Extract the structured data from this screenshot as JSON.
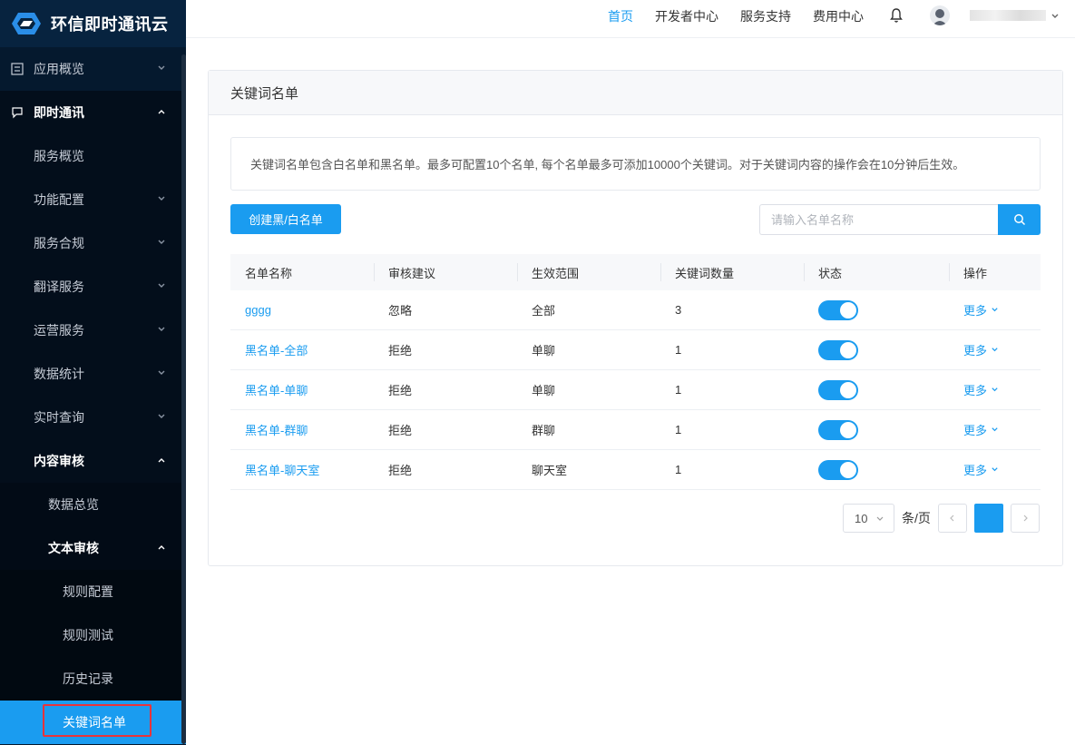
{
  "app": {
    "title": "环信即时通讯云"
  },
  "topnav": {
    "items": [
      "首页",
      "开发者中心",
      "服务支持",
      "费用中心"
    ]
  },
  "sidebar": {
    "items": [
      {
        "label": "应用概览",
        "level": 1
      },
      {
        "label": "即时通讯",
        "level": 1
      },
      {
        "label": "服务概览",
        "level": 2
      },
      {
        "label": "功能配置",
        "level": 2
      },
      {
        "label": "服务合规",
        "level": 2
      },
      {
        "label": "翻译服务",
        "level": 2
      },
      {
        "label": "运营服务",
        "level": 2
      },
      {
        "label": "数据统计",
        "level": 2
      },
      {
        "label": "实时查询",
        "level": 2
      },
      {
        "label": "内容审核",
        "level": 2
      },
      {
        "label": "数据总览",
        "level": 3
      },
      {
        "label": "文本审核",
        "level": 3
      },
      {
        "label": "规则配置",
        "level": 4
      },
      {
        "label": "规则测试",
        "level": 4
      },
      {
        "label": "历史记录",
        "level": 4
      },
      {
        "label": "关键词名单",
        "level": 4
      }
    ],
    "active": "关键词名单"
  },
  "panel": {
    "title": "关键词名单",
    "notice": "关键词名单包含白名单和黑名单。最多可配置10个名单, 每个名单最多可添加10000个关键词。对于关键词内容的操作会在10分钟后生效。",
    "create_button": "创建黑/白名单",
    "search_placeholder": "请输入名单名称"
  },
  "table": {
    "headers": [
      "名单名称",
      "审核建议",
      "生效范围",
      "关键词数量",
      "状态",
      "操作"
    ],
    "rows": [
      {
        "name": "gggg",
        "advice": "忽略",
        "scope": "全部",
        "count": "3",
        "enabled": true,
        "action": "更多"
      },
      {
        "name": "黑名单-全部",
        "advice": "拒绝",
        "scope": "单聊",
        "count": "1",
        "enabled": true,
        "action": "更多"
      },
      {
        "name": "黑名单-单聊",
        "advice": "拒绝",
        "scope": "单聊",
        "count": "1",
        "enabled": true,
        "action": "更多"
      },
      {
        "name": "黑名单-群聊",
        "advice": "拒绝",
        "scope": "群聊",
        "count": "1",
        "enabled": true,
        "action": "更多"
      },
      {
        "name": "黑名单-聊天室",
        "advice": "拒绝",
        "scope": "聊天室",
        "count": "1",
        "enabled": true,
        "action": "更多"
      }
    ]
  },
  "pagination": {
    "page_size": "10",
    "per_page_label": "条/页"
  },
  "colors": {
    "accent": "#1a9cf0",
    "sidebar_bg": "#05192e",
    "highlight": "#e8343b"
  },
  "icons": {
    "logo": "hexagon-logo-icon",
    "overview": "list-icon",
    "im": "chat-bubble-icon",
    "bell": "bell-icon",
    "search": "search-icon",
    "chevron": "chevron-down-icon"
  }
}
